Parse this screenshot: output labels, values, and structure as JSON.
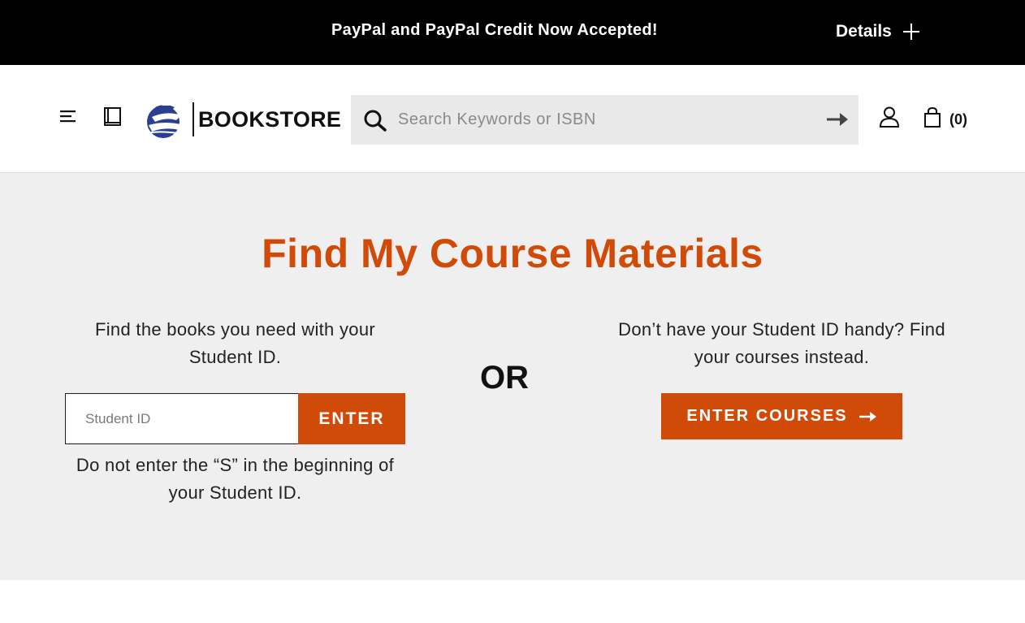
{
  "promo": {
    "text": "PayPal and PayPal Credit Now Accepted!",
    "details_label": "Details",
    "details_icon": "plus-icon"
  },
  "header": {
    "menu_icon": "hamburger-menu-icon",
    "book_icon": "book-icon",
    "logo_icon": "ship-logo-icon",
    "logo_text": "BOOKSTORE",
    "search": {
      "placeholder": "Search Keywords or ISBN",
      "value": "",
      "icon": "search-icon",
      "submit_icon": "arrow-right-icon"
    },
    "account_icon": "user-icon",
    "cart_icon": "shopping-bag-icon",
    "cart_count": "(0)"
  },
  "main": {
    "title": "Find My Course Materials",
    "left": {
      "description": "Find the books you need with your Student ID.",
      "input_placeholder": "Student ID",
      "input_value": "",
      "enter_label": "ENTER",
      "note": "Do not enter the “S” in the beginning of your Student ID."
    },
    "or_label": "OR",
    "right": {
      "description": "Don’t have your Student ID handy? Find your courses instead.",
      "button_label": "ENTER COURSES",
      "button_icon": "arrow-right-icon"
    }
  },
  "colors": {
    "accent": "#d04a08",
    "promo_bg": "#000000",
    "main_bg": "#efefef",
    "search_bg": "#e9e9e9",
    "logo_blue": "#2a3f8f"
  }
}
